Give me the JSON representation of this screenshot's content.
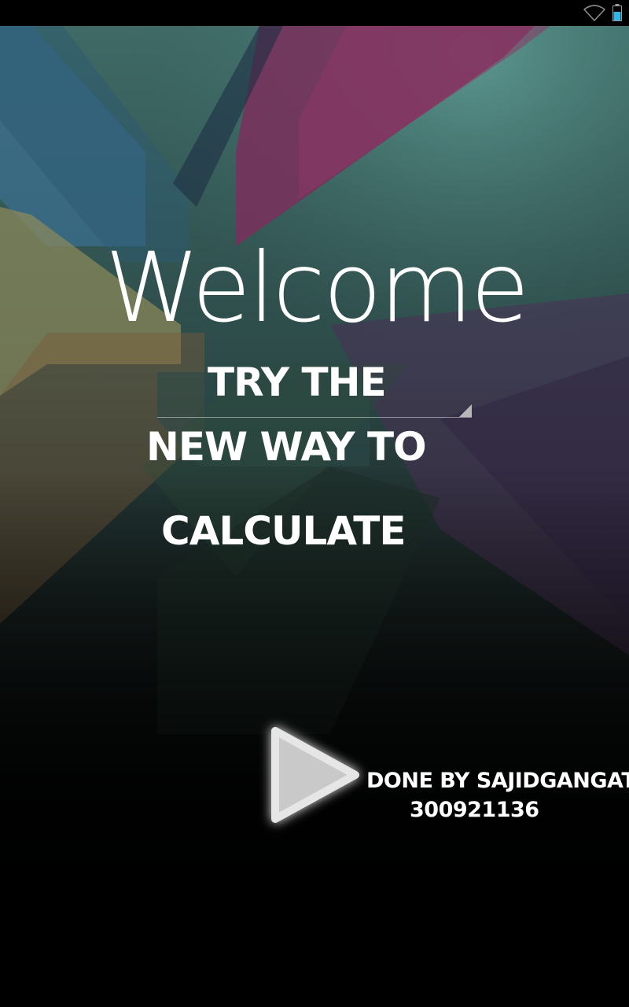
{
  "status_bar": {
    "icons": [
      "wifi-icon",
      "battery-icon"
    ],
    "battery_color": "#33b5e5"
  },
  "welcome": {
    "title": "Welcome",
    "headline": {
      "line1": "TRY THE",
      "line2": "NEW WAY TO",
      "line3": "CALCULATE"
    },
    "start_icon": "play-icon"
  },
  "credits": {
    "name": "DONE BY SAJIDGANGAT",
    "id": "300921136"
  },
  "colors": {
    "text": "#ffffff",
    "background": "#000000",
    "wallpaper_teal": "#4a8a82",
    "wallpaper_purple": "#7a3a6a",
    "wallpaper_blue": "#3a6a8a",
    "wallpaper_olive": "#8a8556"
  }
}
